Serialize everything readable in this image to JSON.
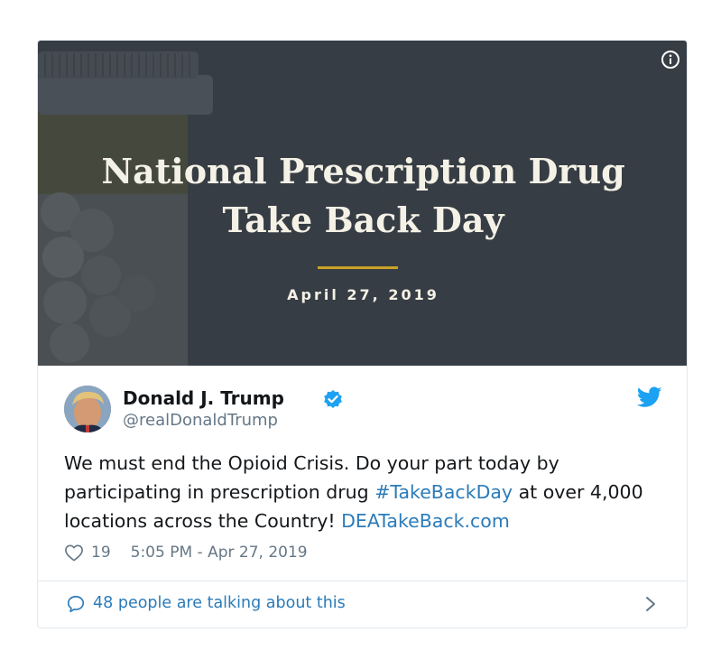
{
  "hero": {
    "title_line1": "National Prescription Drug",
    "title_line2": "Take Back Day",
    "date": "April 27, 2019",
    "info_icon": "info-circle-icon"
  },
  "author": {
    "name": "Donald J. Trump",
    "handle": "@realDonaldTrump",
    "verified": true
  },
  "tweet": {
    "text_part1": "We must end the Opioid Crisis. Do your part today by participating in prescription drug ",
    "hashtag": "#TakeBackDay",
    "text_part2": " at over 4,000 locations across the Country! ",
    "link": "DEATakeBack.com"
  },
  "meta": {
    "likes": "19",
    "timestamp": "5:05 PM - Apr 27, 2019"
  },
  "footer": {
    "talking": "48 people are talking about this"
  },
  "colors": {
    "link": "#2b7bb9",
    "hero_bg": "#373d44",
    "accent_rule": "#c9a227",
    "verified": "#1da1f2",
    "secondary_text": "#657786"
  }
}
